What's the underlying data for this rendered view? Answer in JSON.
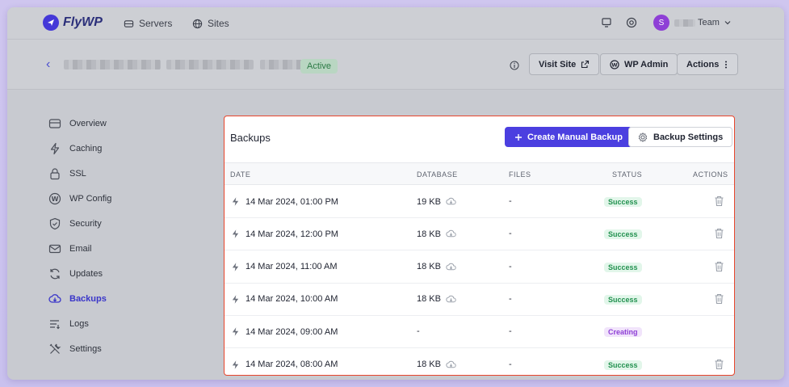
{
  "nav": {
    "logo": "FlyWP",
    "links": [
      {
        "label": "Servers",
        "icon": "server-icon"
      },
      {
        "label": "Sites",
        "icon": "globe-icon"
      }
    ],
    "user": {
      "initial": "S",
      "team_label": "Team"
    }
  },
  "site": {
    "status": "Active",
    "buttons": {
      "visit": "Visit Site",
      "wp_admin": "WP Admin",
      "actions": "Actions"
    }
  },
  "sidebar": {
    "items": [
      {
        "label": "Overview",
        "icon": "overview-icon",
        "active": false
      },
      {
        "label": "Caching",
        "icon": "lightning-icon",
        "active": false
      },
      {
        "label": "SSL",
        "icon": "lock-icon",
        "active": false
      },
      {
        "label": "WP Config",
        "icon": "wordpress-icon",
        "active": false
      },
      {
        "label": "Security",
        "icon": "shield-icon",
        "active": false
      },
      {
        "label": "Email",
        "icon": "mail-icon",
        "active": false
      },
      {
        "label": "Updates",
        "icon": "refresh-icon",
        "active": false
      },
      {
        "label": "Backups",
        "icon": "cloud-download-icon",
        "active": true
      },
      {
        "label": "Logs",
        "icon": "list-icon",
        "active": false
      },
      {
        "label": "Settings",
        "icon": "tools-icon",
        "active": false
      }
    ]
  },
  "backups": {
    "title": "Backups",
    "create_label": "Create Manual Backup",
    "settings_label": "Backup Settings",
    "columns": {
      "date": "DATE",
      "database": "DATABASE",
      "files": "FILES",
      "status": "STATUS",
      "actions": "ACTIONS"
    },
    "rows": [
      {
        "date": "14 Mar 2024, 01:00 PM",
        "database": "19 KB",
        "files": "-",
        "status": "Success",
        "status_type": "success"
      },
      {
        "date": "14 Mar 2024, 12:00 PM",
        "database": "18 KB",
        "files": "-",
        "status": "Success",
        "status_type": "success"
      },
      {
        "date": "14 Mar 2024, 11:00 AM",
        "database": "18 KB",
        "files": "-",
        "status": "Success",
        "status_type": "success"
      },
      {
        "date": "14 Mar 2024, 10:00 AM",
        "database": "18 KB",
        "files": "-",
        "status": "Success",
        "status_type": "success"
      },
      {
        "date": "14 Mar 2024, 09:00 AM",
        "database": "-",
        "files": "-",
        "status": "Creating",
        "status_type": "creating"
      },
      {
        "date": "14 Mar 2024, 08:00 AM",
        "database": "18 KB",
        "files": "-",
        "status": "Success",
        "status_type": "success"
      }
    ]
  },
  "colors": {
    "accent": "#4b3fe0",
    "success": "#22914f",
    "creating": "#8e3fd6",
    "highlight": "#e7452c"
  }
}
